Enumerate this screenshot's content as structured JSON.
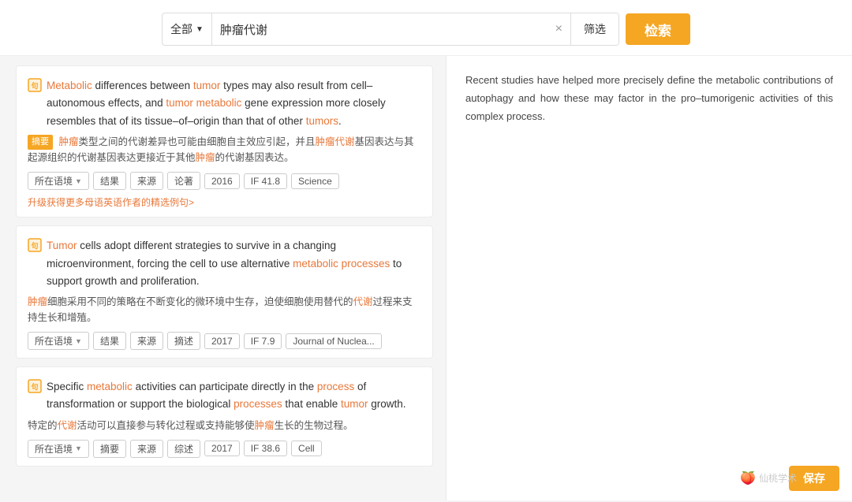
{
  "search": {
    "category_label": "全部",
    "query": "肿瘤代谢",
    "clear_label": "×",
    "filter_label": "筛选",
    "search_label": "检索"
  },
  "results": [
    {
      "id": "r1",
      "en_text_parts": [
        {
          "text": "Metabolic",
          "type": "highlight"
        },
        {
          "text": " differences between ",
          "type": "normal"
        },
        {
          "text": "tumor",
          "type": "highlight"
        },
        {
          "text": " types may also result from cell–autonomous effects, and ",
          "type": "normal"
        },
        {
          "text": "tumor",
          "type": "highlight"
        },
        {
          "text": " ",
          "type": "normal"
        },
        {
          "text": "metabolic",
          "type": "highlight"
        },
        {
          "text": " gene expression more closely resembles that of its tissue–of–origin than that of other ",
          "type": "normal"
        },
        {
          "text": "tumors",
          "type": "highlight"
        },
        {
          "text": ".",
          "type": "normal"
        }
      ],
      "zh_badge": "摘要",
      "zh_text_parts": [
        {
          "text": "肿瘤",
          "type": "highlight"
        },
        {
          "text": "类型之间的代谢差异也可能由细胞自主效应引起，并且",
          "type": "normal"
        },
        {
          "text": "肿瘤代谢",
          "type": "highlight"
        },
        {
          "text": "基因表达与其起源组织的代谢基因表达更接近于其他",
          "type": "normal"
        },
        {
          "text": "肿瘤",
          "type": "highlight"
        },
        {
          "text": "的代谢基因表达。",
          "type": "normal"
        }
      ],
      "tags": [
        "所在语境",
        "结果",
        "来源",
        "论著",
        "2016",
        "IF 41.8",
        "Science"
      ],
      "upgrade_link": "升级获得更多母语英语作者的精选例句>"
    },
    {
      "id": "r2",
      "en_text_parts": [
        {
          "text": "Tumor",
          "type": "highlight"
        },
        {
          "text": " cells adopt different strategies to survive in a changing microenvironment, forcing the cell to use alternative ",
          "type": "normal"
        },
        {
          "text": "metabolic processes",
          "type": "highlight"
        },
        {
          "text": " to support growth and proliferation.",
          "type": "normal"
        }
      ],
      "zh_badge": null,
      "zh_text_parts": [
        {
          "text": "肿瘤",
          "type": "highlight"
        },
        {
          "text": "细胞采用不同的策略在不断变化的微环境中生存，迫使细胞使用替代的",
          "type": "normal"
        },
        {
          "text": "代谢",
          "type": "highlight"
        },
        {
          "text": "过程来支持生长和增殖。",
          "type": "normal"
        }
      ],
      "tags": [
        "所在语境",
        "结果",
        "来源",
        "摘述",
        "2017",
        "IF 7.9",
        "Journal of Nuclea..."
      ],
      "upgrade_link": null
    },
    {
      "id": "r3",
      "en_text_parts": [
        {
          "text": "Specific ",
          "type": "normal"
        },
        {
          "text": "metabolic",
          "type": "highlight"
        },
        {
          "text": " activities can participate directly in the ",
          "type": "normal"
        },
        {
          "text": "process",
          "type": "highlight"
        },
        {
          "text": " of transformation or support the biological ",
          "type": "normal"
        },
        {
          "text": "processes",
          "type": "highlight"
        },
        {
          "text": " that enable ",
          "type": "normal"
        },
        {
          "text": "tumor",
          "type": "highlight"
        },
        {
          "text": " growth.",
          "type": "normal"
        }
      ],
      "zh_badge": null,
      "zh_text_parts": [
        {
          "text": "特定的",
          "type": "normal"
        },
        {
          "text": "代谢",
          "type": "highlight"
        },
        {
          "text": "活动可以直接参与转化过程或支持能够使",
          "type": "normal"
        },
        {
          "text": "肿瘤",
          "type": "highlight"
        },
        {
          "text": "生长的生物过程。",
          "type": "normal"
        }
      ],
      "tags": [
        "所在语境",
        "摘要",
        "来源",
        "综述",
        "2017",
        "IF 38.6",
        "Cell"
      ],
      "upgrade_link": null
    }
  ],
  "detail": {
    "text": "Recent studies have helped more precisely define the metabolic contributions of autophagy and how these may factor in the pro–tumorigenic activities of this complex process."
  },
  "save_button": "保存",
  "watermark": "仙桃学术"
}
